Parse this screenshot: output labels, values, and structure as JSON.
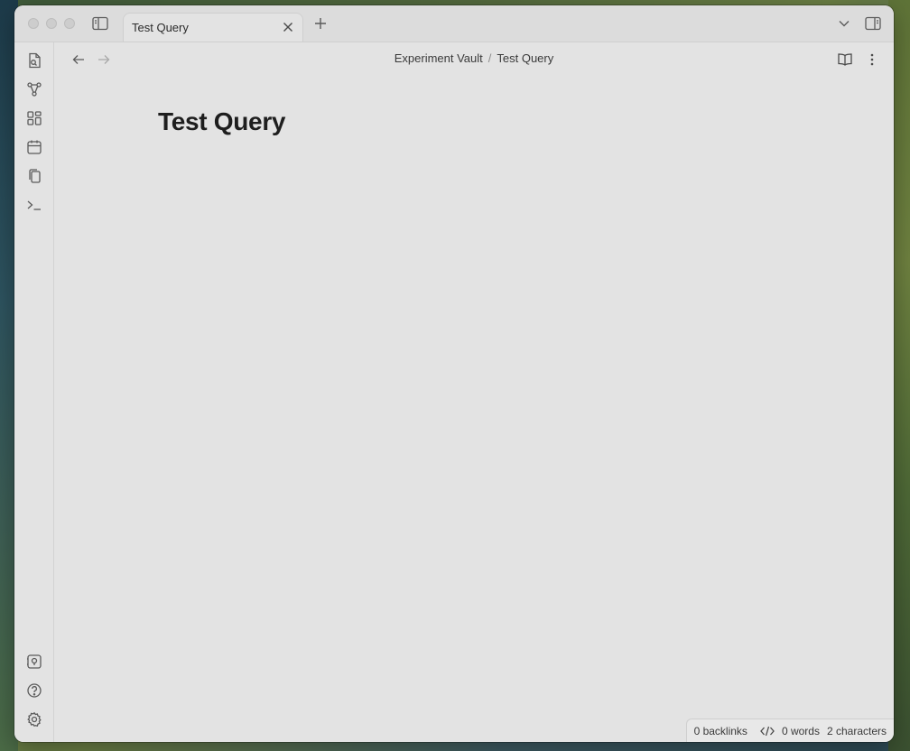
{
  "tab": {
    "title": "Test Query"
  },
  "breadcrumb": {
    "vault": "Experiment Vault",
    "separator": "/",
    "note": "Test Query"
  },
  "document": {
    "title": "Test Query"
  },
  "status": {
    "backlinks": "0 backlinks",
    "words": "0 words",
    "characters": "2 characters"
  },
  "icons": {
    "ribbon_top": [
      "quick-switcher-icon",
      "graph-view-icon",
      "canvas-icon",
      "calendar-icon",
      "templates-icon",
      "command-palette-icon"
    ],
    "ribbon_bottom": [
      "vault-switcher-icon",
      "help-icon",
      "settings-icon"
    ]
  },
  "colors": {
    "window_bg": "#e3e3e3",
    "text": "#1e1e1e"
  }
}
